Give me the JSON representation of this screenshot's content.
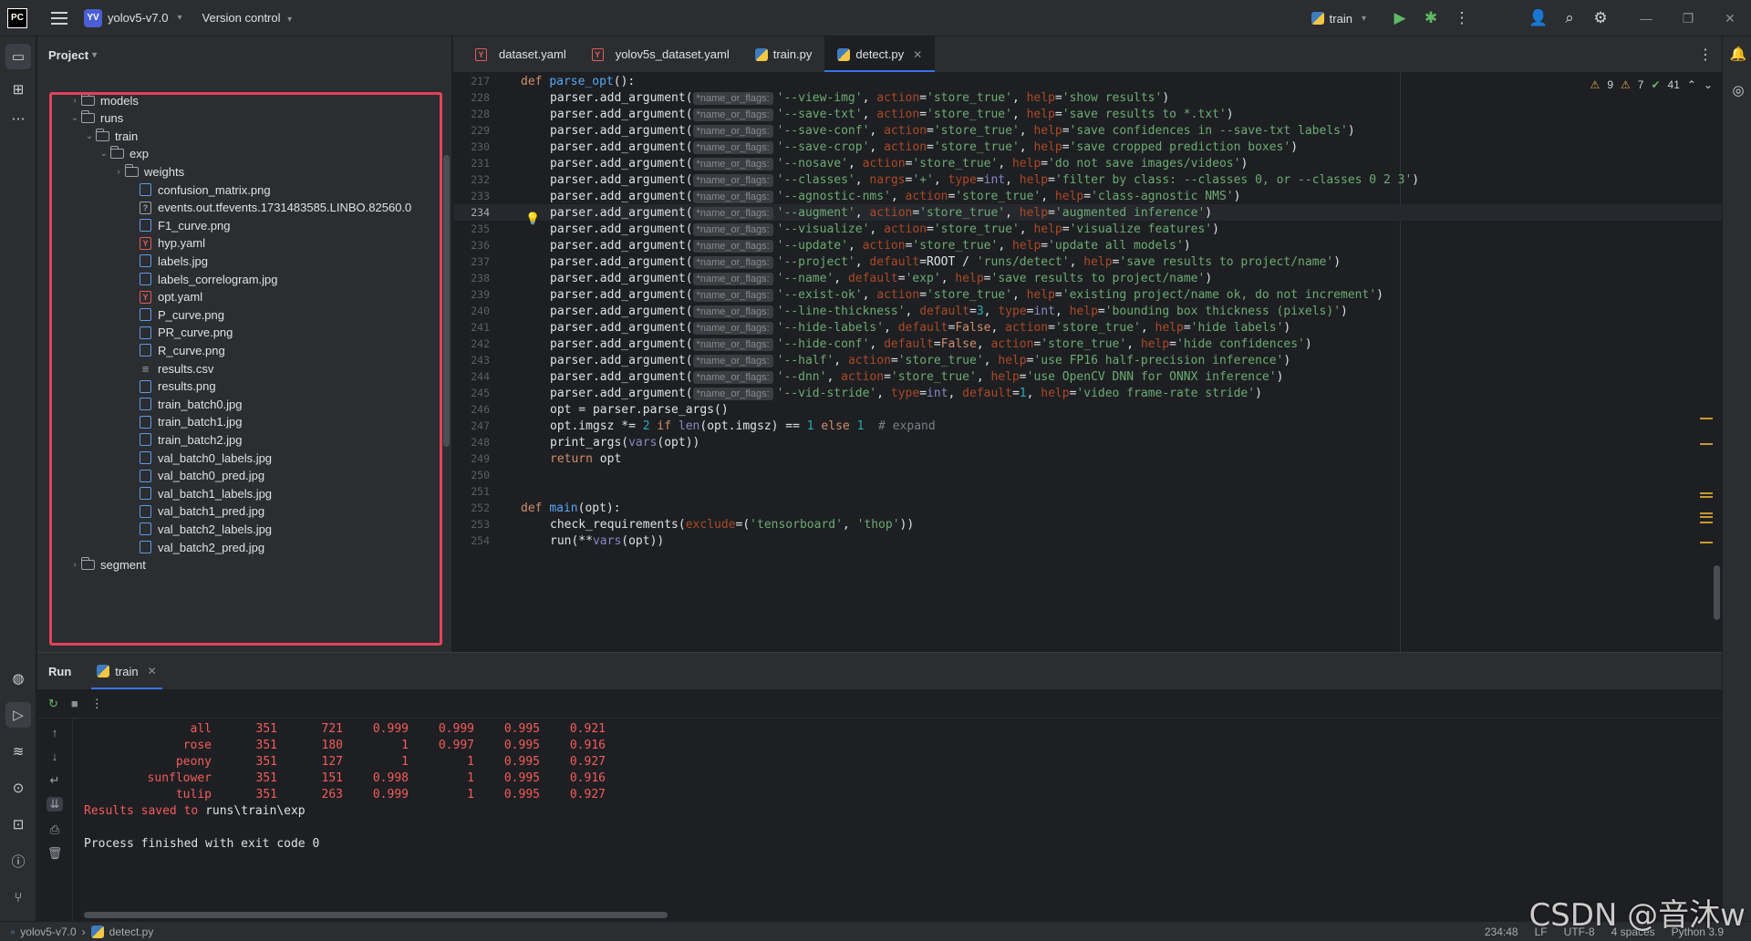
{
  "titlebar": {
    "logo": "PC",
    "project_badge": "YV",
    "project_name": "yolov5-v7.0",
    "version_control": "Version control",
    "run_config": "train"
  },
  "project_panel": {
    "title": "Project",
    "tree": [
      {
        "label": "models",
        "kind": "folder",
        "depth": 1,
        "arrow": "›"
      },
      {
        "label": "runs",
        "kind": "folder",
        "depth": 1,
        "arrow": "⌄"
      },
      {
        "label": "train",
        "kind": "folder",
        "depth": 2,
        "arrow": "⌄"
      },
      {
        "label": "exp",
        "kind": "folder",
        "depth": 3,
        "arrow": "⌄"
      },
      {
        "label": "weights",
        "kind": "folder",
        "depth": 4,
        "arrow": "›"
      },
      {
        "label": "confusion_matrix.png",
        "kind": "img",
        "depth": 5
      },
      {
        "label": "events.out.tfevents.1731483585.LINBO.82560.0",
        "kind": "unk",
        "depth": 5
      },
      {
        "label": "F1_curve.png",
        "kind": "img",
        "depth": 5
      },
      {
        "label": "hyp.yaml",
        "kind": "yaml",
        "depth": 5
      },
      {
        "label": "labels.jpg",
        "kind": "img",
        "depth": 5
      },
      {
        "label": "labels_correlogram.jpg",
        "kind": "img",
        "depth": 5
      },
      {
        "label": "opt.yaml",
        "kind": "yaml",
        "depth": 5
      },
      {
        "label": "P_curve.png",
        "kind": "img",
        "depth": 5
      },
      {
        "label": "PR_curve.png",
        "kind": "img",
        "depth": 5
      },
      {
        "label": "R_curve.png",
        "kind": "img",
        "depth": 5
      },
      {
        "label": "results.csv",
        "kind": "csv",
        "depth": 5
      },
      {
        "label": "results.png",
        "kind": "img",
        "depth": 5
      },
      {
        "label": "train_batch0.jpg",
        "kind": "img",
        "depth": 5
      },
      {
        "label": "train_batch1.jpg",
        "kind": "img",
        "depth": 5
      },
      {
        "label": "train_batch2.jpg",
        "kind": "img",
        "depth": 5
      },
      {
        "label": "val_batch0_labels.jpg",
        "kind": "img",
        "depth": 5
      },
      {
        "label": "val_batch0_pred.jpg",
        "kind": "img",
        "depth": 5
      },
      {
        "label": "val_batch1_labels.jpg",
        "kind": "img",
        "depth": 5
      },
      {
        "label": "val_batch1_pred.jpg",
        "kind": "img",
        "depth": 5
      },
      {
        "label": "val_batch2_labels.jpg",
        "kind": "img",
        "depth": 5
      },
      {
        "label": "val_batch2_pred.jpg",
        "kind": "img",
        "depth": 5
      },
      {
        "label": "segment",
        "kind": "folder",
        "depth": 1,
        "arrow": "›"
      }
    ]
  },
  "editor": {
    "tabs": [
      {
        "label": "dataset.yaml",
        "icon": "yaml",
        "active": false
      },
      {
        "label": "yolov5s_dataset.yaml",
        "icon": "yaml",
        "active": false
      },
      {
        "label": "train.py",
        "icon": "py",
        "active": false
      },
      {
        "label": "detect.py",
        "icon": "py",
        "active": true
      }
    ],
    "inspections": {
      "warnings_a": "9",
      "warnings_b": "7",
      "ok": "41"
    },
    "hint_label": "*name_or_flags:",
    "current_line": 234,
    "lines": [
      {
        "n": "217",
        "t": "def_sig",
        "name": "parse_opt",
        "rest": "():"
      },
      {
        "n": "228",
        "t": "arg",
        "flag": "'--view-img'",
        "kv": [
          [
            "action",
            "'store_true'"
          ],
          [
            "help",
            "'show results'"
          ]
        ]
      },
      {
        "n": "228",
        "t": "arg",
        "flag": "'--save-txt'",
        "kv": [
          [
            "action",
            "'store_true'"
          ],
          [
            "help",
            "'save results to *.txt'"
          ]
        ]
      },
      {
        "n": "229",
        "t": "arg",
        "flag": "'--save-conf'",
        "kv": [
          [
            "action",
            "'store_true'"
          ],
          [
            "help",
            "'save confidences in --save-txt labels'"
          ]
        ]
      },
      {
        "n": "230",
        "t": "arg",
        "flag": "'--save-crop'",
        "kv": [
          [
            "action",
            "'store_true'"
          ],
          [
            "help",
            "'save cropped prediction boxes'"
          ]
        ]
      },
      {
        "n": "231",
        "t": "arg",
        "flag": "'--nosave'",
        "kv": [
          [
            "action",
            "'store_true'"
          ],
          [
            "help",
            "'do not save images/videos'"
          ]
        ]
      },
      {
        "n": "232",
        "t": "arg",
        "flag": "'--classes'",
        "kv": [
          [
            "nargs",
            "'+'"
          ],
          [
            "type",
            "int"
          ],
          [
            "help",
            "'filter by class: --classes 0, or --classes 0 2 3'"
          ]
        ]
      },
      {
        "n": "233",
        "t": "arg",
        "flag": "'--agnostic-nms'",
        "kv": [
          [
            "action",
            "'store_true'"
          ],
          [
            "help",
            "'class-agnostic NMS'"
          ]
        ]
      },
      {
        "n": "234",
        "t": "arg",
        "flag": "'--augment'",
        "kv": [
          [
            "action",
            "'store_true'"
          ],
          [
            "help",
            "'augmented inference'"
          ]
        ]
      },
      {
        "n": "235",
        "t": "arg",
        "flag": "'--visualize'",
        "kv": [
          [
            "action",
            "'store_true'"
          ],
          [
            "help",
            "'visualize features'"
          ]
        ]
      },
      {
        "n": "236",
        "t": "arg",
        "flag": "'--update'",
        "kv": [
          [
            "action",
            "'store_true'"
          ],
          [
            "help",
            "'update all models'"
          ]
        ]
      },
      {
        "n": "237",
        "t": "arg",
        "flag": "'--project'",
        "kv": [
          [
            "default",
            "ROOT / 'runs/detect'"
          ],
          [
            "help",
            "'save results to project/name'"
          ]
        ]
      },
      {
        "n": "238",
        "t": "arg",
        "flag": "'--name'",
        "kv": [
          [
            "default",
            "'exp'"
          ],
          [
            "help",
            "'save results to project/name'"
          ]
        ]
      },
      {
        "n": "239",
        "t": "arg",
        "flag": "'--exist-ok'",
        "kv": [
          [
            "action",
            "'store_true'"
          ],
          [
            "help",
            "'existing project/name ok, do not increment'"
          ]
        ]
      },
      {
        "n": "240",
        "t": "arg",
        "flag": "'--line-thickness'",
        "kv": [
          [
            "default",
            "3"
          ],
          [
            "type",
            "int"
          ],
          [
            "help",
            "'bounding box thickness (pixels)'"
          ]
        ]
      },
      {
        "n": "241",
        "t": "arg",
        "flag": "'--hide-labels'",
        "kv": [
          [
            "default",
            "False"
          ],
          [
            "action",
            "'store_true'"
          ],
          [
            "help",
            "'hide labels'"
          ]
        ]
      },
      {
        "n": "242",
        "t": "arg",
        "flag": "'--hide-conf'",
        "kv": [
          [
            "default",
            "False"
          ],
          [
            "action",
            "'store_true'"
          ],
          [
            "help",
            "'hide confidences'"
          ]
        ]
      },
      {
        "n": "243",
        "t": "arg",
        "flag": "'--half'",
        "kv": [
          [
            "action",
            "'store_true'"
          ],
          [
            "help",
            "'use FP16 half-precision inference'"
          ]
        ]
      },
      {
        "n": "244",
        "t": "arg",
        "flag": "'--dnn'",
        "kv": [
          [
            "action",
            "'store_true'"
          ],
          [
            "help",
            "'use OpenCV DNN for ONNX inference'"
          ]
        ]
      },
      {
        "n": "245",
        "t": "arg",
        "flag": "'--vid-stride'",
        "kv": [
          [
            "type",
            "int"
          ],
          [
            "default",
            "1"
          ],
          [
            "help",
            "'video frame-rate stride'"
          ]
        ]
      },
      {
        "n": "246",
        "t": "plain",
        "text": "opt = parser.parse_args()"
      },
      {
        "n": "247",
        "t": "imgsz",
        "text": "opt.imgsz *= 2 if len(opt.imgsz) == 1 else 1  # expand"
      },
      {
        "n": "248",
        "t": "plain2",
        "text": "print_args(vars(opt))"
      },
      {
        "n": "249",
        "t": "ret",
        "text": "return opt"
      },
      {
        "n": "250",
        "t": "empty",
        "text": ""
      },
      {
        "n": "251",
        "t": "empty",
        "text": ""
      },
      {
        "n": "252",
        "t": "def_sig",
        "name": "main",
        "rest": "(opt):"
      },
      {
        "n": "253",
        "t": "check",
        "text": "check_requirements(exclude=('tensorboard', 'thop'))"
      },
      {
        "n": "254",
        "t": "runline",
        "text": "run(**vars(opt))"
      }
    ]
  },
  "run_panel": {
    "title": "Run",
    "tab": "train",
    "results": [
      {
        "cls": "all",
        "images": "351",
        "instances": "721",
        "p": "0.999",
        "r": "0.999",
        "map50": "0.995",
        "map": "0.921"
      },
      {
        "cls": "rose",
        "images": "351",
        "instances": "180",
        "p": "1",
        "r": "0.997",
        "map50": "0.995",
        "map": "0.916"
      },
      {
        "cls": "peony",
        "images": "351",
        "instances": "127",
        "p": "1",
        "r": "1",
        "map50": "0.995",
        "map": "0.927"
      },
      {
        "cls": "sunflower",
        "images": "351",
        "instances": "151",
        "p": "0.998",
        "r": "1",
        "map50": "0.995",
        "map": "0.916"
      },
      {
        "cls": "tulip",
        "images": "351",
        "instances": "263",
        "p": "0.999",
        "r": "1",
        "map50": "0.995",
        "map": "0.927"
      }
    ],
    "saved_prefix": "Results saved to ",
    "saved_path": "runs\\train\\exp",
    "finished": "Process finished with exit code 0"
  },
  "statusbar": {
    "project": "yolov5-v7.0",
    "file": "detect.py",
    "position": "234:48",
    "line_sep": "LF",
    "encoding": "UTF-8",
    "indent": "4 spaces",
    "interpreter": "Python 3.9"
  },
  "watermark": "CSDN @音沐w",
  "colors": {
    "accent": "#3574f0",
    "highlight_box": "#e0435a",
    "console_red": "#f25c5c"
  }
}
